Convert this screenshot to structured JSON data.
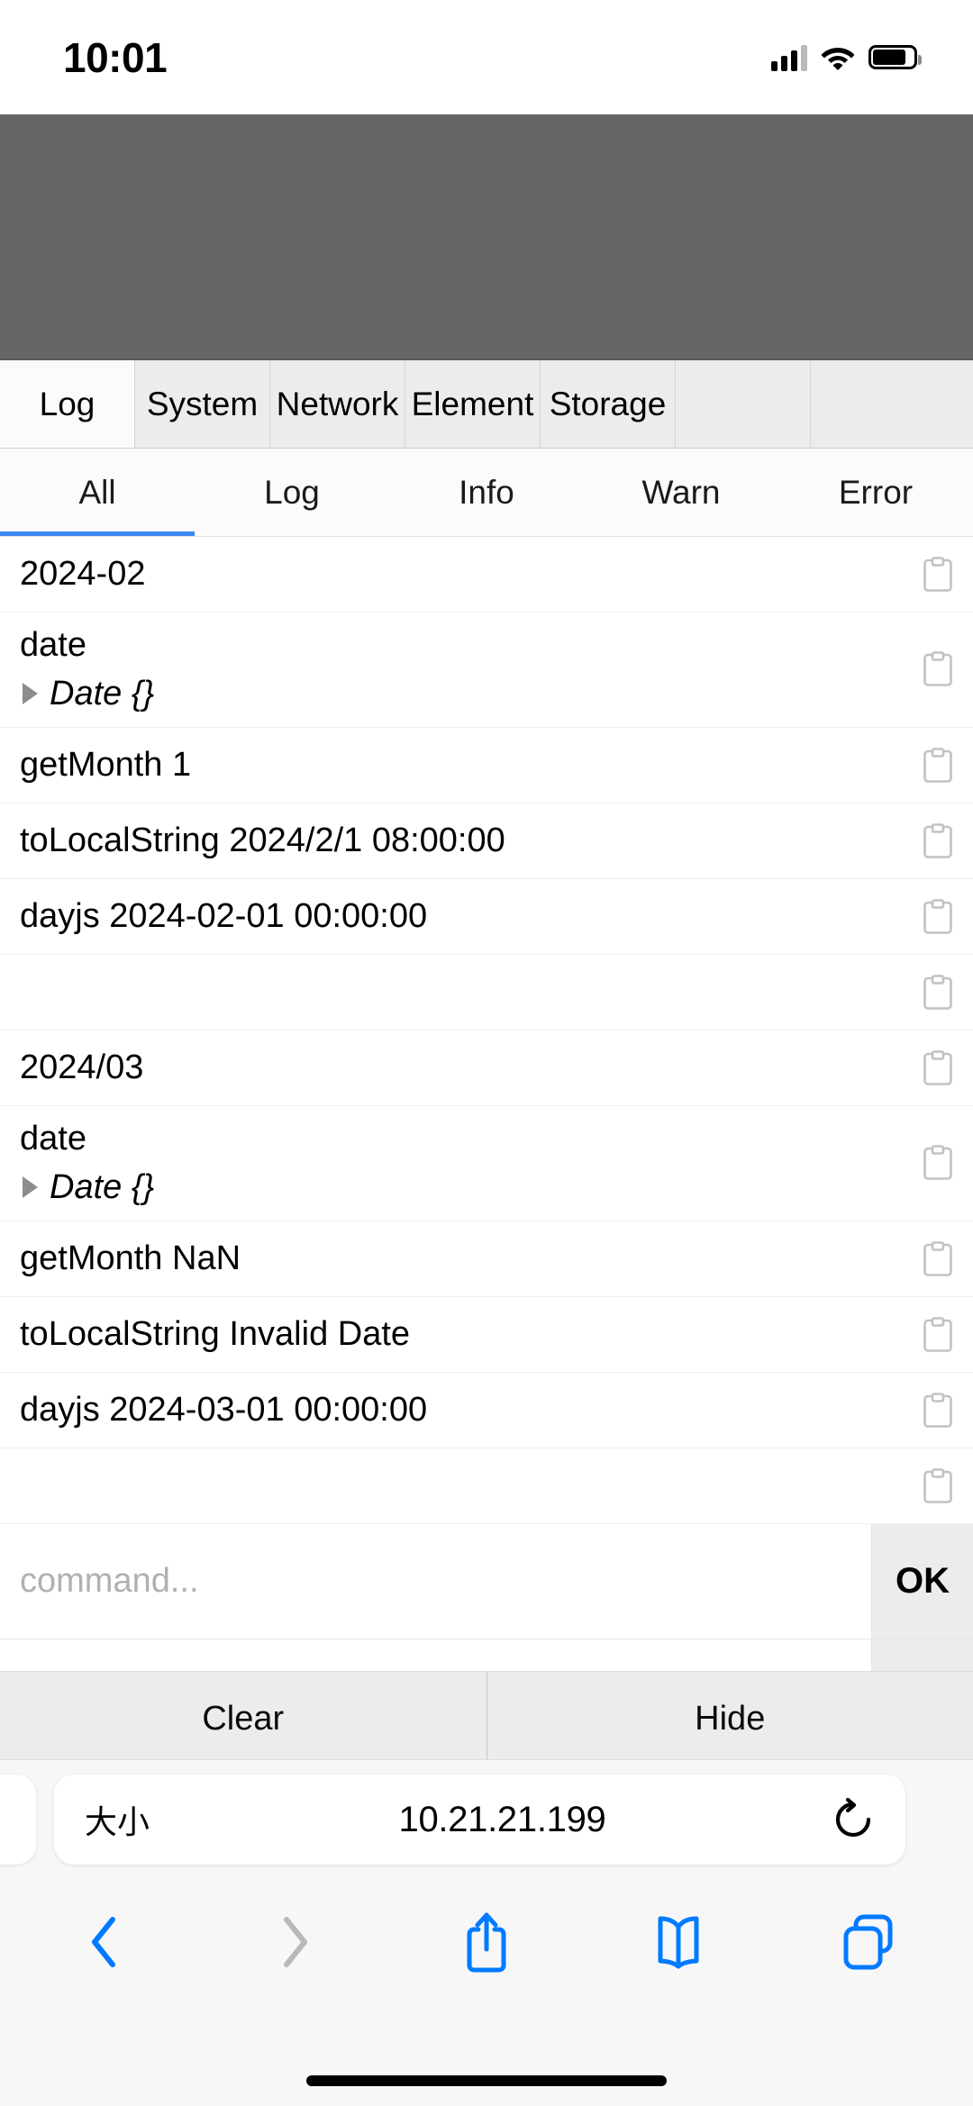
{
  "statusbar": {
    "time": "10:01",
    "signal_icon": "cellular-bars-icon",
    "wifi_icon": "wifi-icon",
    "battery_icon": "battery-icon"
  },
  "console": {
    "tabs": [
      {
        "label": "Log",
        "active": true
      },
      {
        "label": "System",
        "active": false
      },
      {
        "label": "Network",
        "active": false
      },
      {
        "label": "Element",
        "active": false
      },
      {
        "label": "Storage",
        "active": false
      },
      {
        "label": "",
        "active": false
      }
    ],
    "filters": [
      {
        "label": "All",
        "active": true
      },
      {
        "label": "Log",
        "active": false
      },
      {
        "label": "Info",
        "active": false
      },
      {
        "label": "Warn",
        "active": false
      },
      {
        "label": "Error",
        "active": false
      }
    ],
    "logs": [
      {
        "text": "2024-02",
        "sub": "",
        "tall": false
      },
      {
        "text": "date",
        "sub": "Date {}",
        "tall": true
      },
      {
        "text": "getMonth 1",
        "sub": "",
        "tall": false
      },
      {
        "text": "toLocalString 2024/2/1 08:00:00",
        "sub": "",
        "tall": false
      },
      {
        "text": "dayjs 2024-02-01 00:00:00",
        "sub": "",
        "tall": false
      },
      {
        "text": "",
        "sub": "",
        "tall": false
      },
      {
        "text": "2024/03",
        "sub": "",
        "tall": false
      },
      {
        "text": "date",
        "sub": "Date {}",
        "tall": true
      },
      {
        "text": "getMonth NaN",
        "sub": "",
        "tall": false
      },
      {
        "text": "toLocalString Invalid Date",
        "sub": "",
        "tall": false
      },
      {
        "text": "dayjs 2024-03-01 00:00:00",
        "sub": "",
        "tall": false
      },
      {
        "text": "",
        "sub": "",
        "tall": false
      }
    ],
    "command": {
      "placeholder": "command...",
      "value": "",
      "ok_label": "OK"
    },
    "footer": {
      "clear_label": "Clear",
      "hide_label": "Hide"
    },
    "accent_color": "#3b87f0",
    "page_background": "#666666"
  },
  "safari": {
    "text_size_label": "大小",
    "url": "10.21.21.199",
    "reload_icon": "reload-icon",
    "toolbar": {
      "back_icon": "chevron-left-icon",
      "forward_icon": "chevron-right-icon",
      "share_icon": "share-icon",
      "bookmarks_icon": "book-icon",
      "tabs_icon": "tabs-icon"
    },
    "tint_color": "#007aff",
    "disabled_color": "#b8b8b8"
  }
}
